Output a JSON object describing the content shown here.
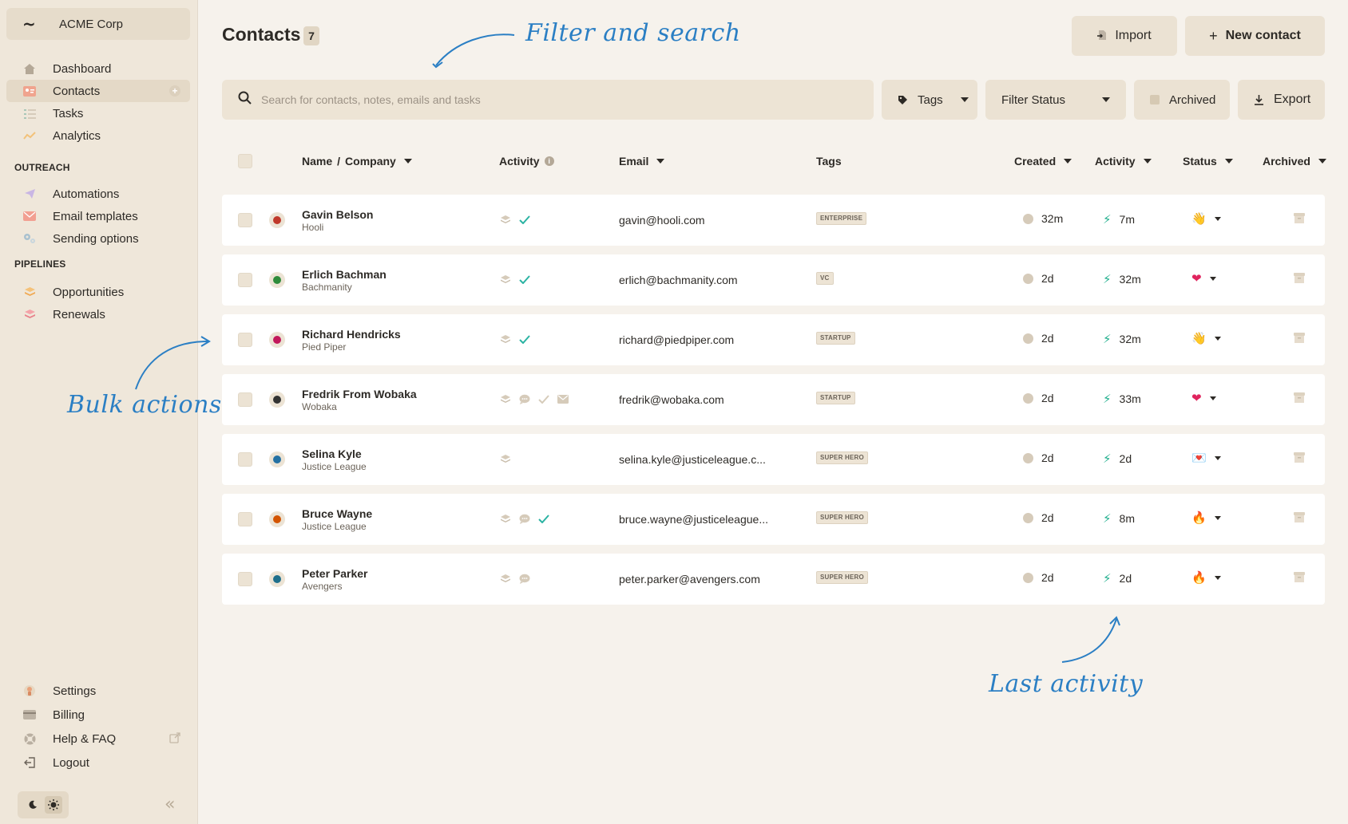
{
  "sidebar": {
    "org_name": "ACME Corp",
    "org_logo": "~",
    "nav": [
      {
        "label": "Dashboard",
        "icon": "home-icon"
      },
      {
        "label": "Contacts",
        "icon": "contacts-icon",
        "active": true
      },
      {
        "label": "Tasks",
        "icon": "tasks-icon"
      },
      {
        "label": "Analytics",
        "icon": "analytics-icon"
      }
    ],
    "outreach_label": "OUTREACH",
    "outreach": [
      {
        "label": "Automations",
        "icon": "paper-plane-icon"
      },
      {
        "label": "Email templates",
        "icon": "envelope-icon"
      },
      {
        "label": "Sending options",
        "icon": "gears-icon"
      }
    ],
    "pipelines_label": "PIPELINES",
    "pipelines": [
      {
        "label": "Opportunities",
        "icon": "stack-icon"
      },
      {
        "label": "Renewals",
        "icon": "stack-icon"
      }
    ],
    "bottom": [
      {
        "label": "Settings",
        "icon": "settings-icon"
      },
      {
        "label": "Billing",
        "icon": "card-icon"
      },
      {
        "label": "Help & FAQ",
        "icon": "help-icon"
      },
      {
        "label": "Logout",
        "icon": "logout-icon"
      }
    ]
  },
  "header": {
    "title": "Contacts",
    "count": "7",
    "import_label": "Import",
    "new_contact_label": "New contact"
  },
  "filters": {
    "search_placeholder": "Search for contacts, notes, emails and tasks",
    "tags_label": "Tags",
    "status_label": "Filter Status",
    "archived_label": "Archived",
    "export_label": "Export"
  },
  "table": {
    "columns": {
      "name": "Name",
      "separator": "/",
      "company": "Company",
      "activity": "Activity",
      "email": "Email",
      "tags": "Tags",
      "created": "Created",
      "last_activity": "Activity",
      "status": "Status",
      "archived": "Archived"
    },
    "rows": [
      {
        "name": "Gavin Belson",
        "company": "Hooli",
        "email": "gavin@hooli.com",
        "tag": "ENTERPRISE",
        "created": "32m",
        "activity": "7m",
        "status": "👋",
        "avatar_color": "#c0392b",
        "acts": [
          "stack",
          "check"
        ]
      },
      {
        "name": "Erlich Bachman",
        "company": "Bachmanity",
        "email": "erlich@bachmanity.com",
        "tag": "VC",
        "created": "2d",
        "activity": "32m",
        "status": "❤",
        "avatar_color": "#2e8b3a",
        "acts": [
          "stack",
          "check"
        ]
      },
      {
        "name": "Richard Hendricks",
        "company": "Pied Piper",
        "email": "richard@piedpiper.com",
        "tag": "STARTUP",
        "created": "2d",
        "activity": "32m",
        "status": "👋",
        "avatar_color": "#c2185b",
        "acts": [
          "stack",
          "check"
        ]
      },
      {
        "name": "Fredrik From Wobaka",
        "company": "Wobaka",
        "email": "fredrik@wobaka.com",
        "tag": "STARTUP",
        "created": "2d",
        "activity": "33m",
        "status": "❤",
        "avatar_color": "#333333",
        "acts": [
          "stack",
          "chat",
          "check-faded",
          "mail"
        ]
      },
      {
        "name": "Selina Kyle",
        "company": "Justice League",
        "email": "selina.kyle@justiceleague.c...",
        "tag": "SUPER HERO",
        "created": "2d",
        "activity": "2d",
        "status": "💌",
        "avatar_color": "#2471a3",
        "acts": [
          "stack"
        ]
      },
      {
        "name": "Bruce Wayne",
        "company": "Justice League",
        "email": "bruce.wayne@justiceleague...",
        "tag": "SUPER HERO",
        "created": "2d",
        "activity": "8m",
        "status": "🔥",
        "avatar_color": "#d35400",
        "acts": [
          "stack",
          "chat",
          "check"
        ]
      },
      {
        "name": "Peter Parker",
        "company": "Avengers",
        "email": "peter.parker@avengers.com",
        "tag": "SUPER HERO",
        "created": "2d",
        "activity": "2d",
        "status": "🔥",
        "avatar_color": "#1f6f8b",
        "acts": [
          "stack",
          "chat"
        ]
      }
    ]
  },
  "annotations": {
    "filter": "Filter and search",
    "bulk": "Bulk actions",
    "last": "Last activity"
  },
  "colors": {
    "accent_annotation": "#2b7fc4",
    "bolt": "#1fae8c",
    "check": "#2bb3a3",
    "background": "#f6f2ec",
    "sidebar": "#efe7da"
  }
}
